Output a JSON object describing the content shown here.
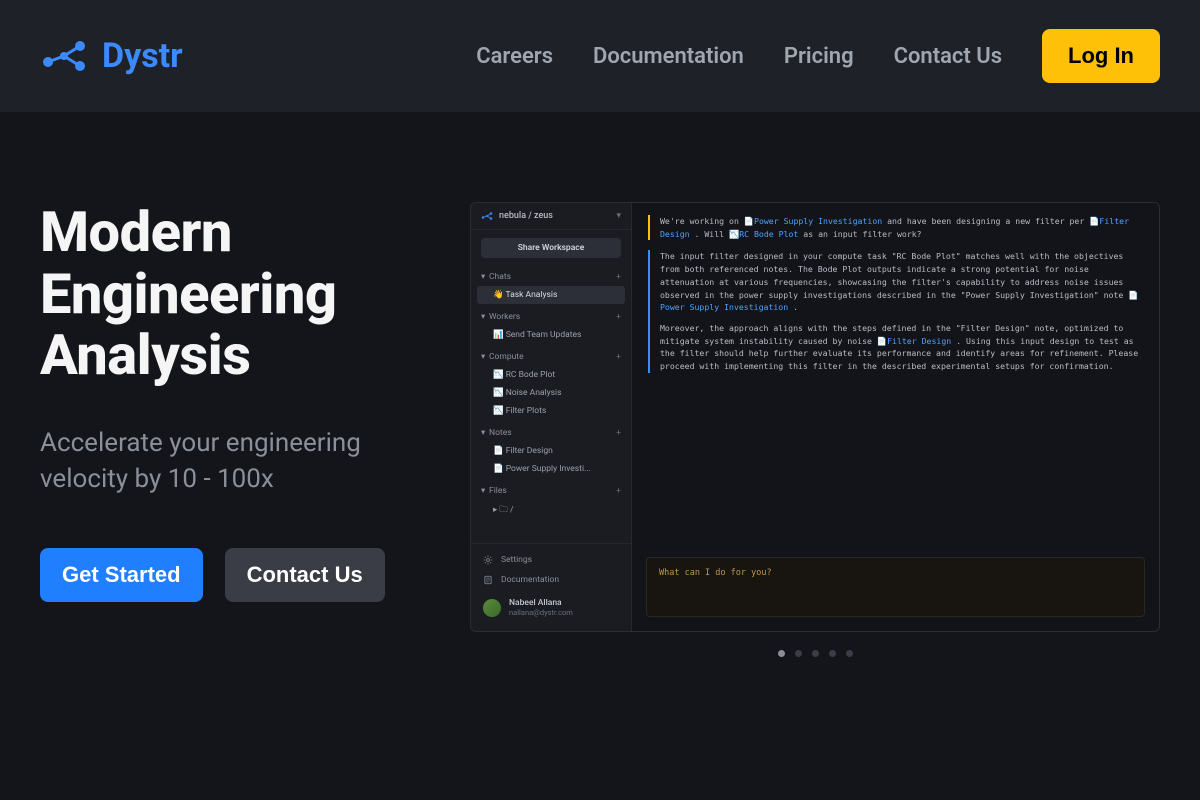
{
  "brand": "Dystr",
  "nav": {
    "careers": "Careers",
    "docs": "Documentation",
    "pricing": "Pricing",
    "contact": "Contact Us",
    "login": "Log In"
  },
  "hero": {
    "title_l1": "Modern",
    "title_l2": "Engineering",
    "title_l3": "Analysis",
    "sub": "Accelerate your engineering velocity by 10 - 100x",
    "cta_primary": "Get Started",
    "cta_secondary": "Contact Us"
  },
  "shot": {
    "workspace": "nebula / zeus",
    "share": "Share Workspace",
    "sections": {
      "chats": {
        "label": "Chats",
        "items": [
          "👋 Task Analysis"
        ]
      },
      "workers": {
        "label": "Workers",
        "items": [
          "📊 Send Team Updates"
        ]
      },
      "compute": {
        "label": "Compute",
        "items": [
          "📉 RC Bode Plot",
          "📉 Noise Analysis",
          "📉 Filter Plots"
        ]
      },
      "notes": {
        "label": "Notes",
        "items": [
          "📄 Filter Design",
          "📄 Power Supply Investi..."
        ]
      },
      "files": {
        "label": "Files",
        "items": [
          "▸ 🗀 /"
        ]
      }
    },
    "bottom": {
      "settings": "Settings",
      "docs": "Documentation"
    },
    "user": {
      "name": "Nabeel Allana",
      "email": "nallana@dystr.com"
    },
    "msg_user": {
      "t1": "We're working on ",
      "tag1": "Power Supply Investigation",
      "t2": " and have been designing a new filter per ",
      "tag2": "Filter Design",
      "t3": " . Will ",
      "tag3": "RC Bode Plot",
      "t4": " as an input filter work?"
    },
    "msg_asst_p1a": "The input filter designed in your compute task \"RC Bode Plot\" matches well with the objectives from both referenced notes. The Bode Plot outputs indicate a strong potential for noise attenuation at various frequencies, showcasing the filter's capability to address noise issues observed in the power supply investigations described in the \"Power Supply Investigation\" note ",
    "msg_asst_p1tag": "Power Supply Investigation",
    "msg_asst_p1b": " .",
    "msg_asst_p2a": "Moreover, the approach aligns with the steps defined in the \"Filter Design\" note, optimized to mitigate system instability caused by noise ",
    "msg_asst_p2tag": "Filter Design",
    "msg_asst_p2b": " . Using this input design to test as the filter should help further evaluate its performance and identify areas for refinement. Please proceed with implementing this filter in the described experimental setups for confirmation.",
    "input_placeholder": "What can I do for you?"
  },
  "carousel": {
    "count": 5,
    "active": 0
  }
}
